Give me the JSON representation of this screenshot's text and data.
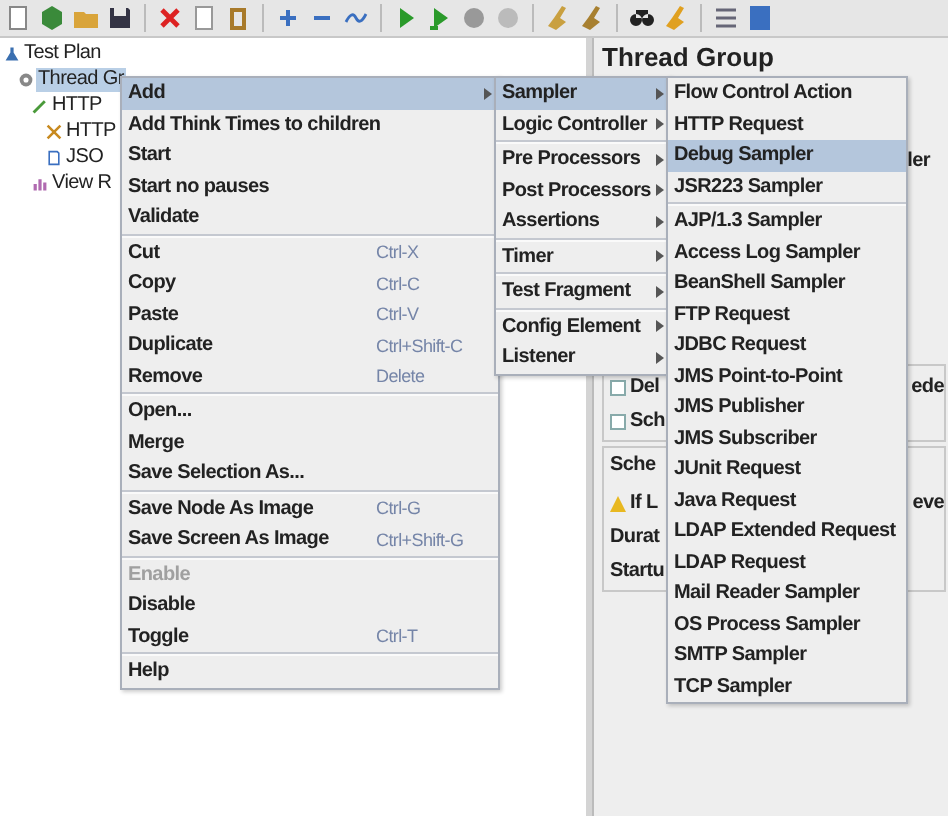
{
  "tree": [
    {
      "label": "Test Plan",
      "kind": "plan",
      "selected": false,
      "children": [
        {
          "label": "Thread Gr",
          "kind": "threads",
          "selected": true,
          "children": [
            {
              "label": "HTTP",
              "kind": "config",
              "selected": false,
              "children": [
                {
                  "label": "HTTP",
                  "kind": "sampler",
                  "selected": false
                },
                {
                  "label": "JSO",
                  "kind": "extractor",
                  "selected": false
                }
              ]
            },
            {
              "label": "View R",
              "kind": "listener",
              "selected": false
            }
          ]
        }
      ]
    }
  ],
  "editor": {
    "title": "Thread Group",
    "hint": "ler",
    "options": [
      {
        "label": "Del",
        "checked": false,
        "tail": "ede"
      },
      {
        "label": "Sch",
        "checked": false
      }
    ],
    "scheduler": {
      "title": "Sche",
      "warning": "If L",
      "warning_tail": "eve",
      "fields": [
        "Durat",
        "Startu"
      ]
    }
  },
  "menus": [
    {
      "items": [
        {
          "kind": "item",
          "label": "Add",
          "selected": true,
          "disabled": false,
          "submenu": true
        },
        {
          "kind": "item",
          "label": "Add Think Times to children",
          "selected": false,
          "disabled": false,
          "submenu": false
        },
        {
          "kind": "item",
          "label": "Start",
          "selected": false,
          "disabled": false,
          "submenu": false
        },
        {
          "kind": "item",
          "label": "Start no pauses",
          "selected": false,
          "disabled": false,
          "submenu": false
        },
        {
          "kind": "item",
          "label": "Validate",
          "selected": false,
          "disabled": false,
          "submenu": false
        },
        {
          "kind": "separator"
        },
        {
          "kind": "item",
          "label": "Cut",
          "shortcut": "Ctrl-X",
          "selected": false,
          "disabled": false,
          "submenu": false
        },
        {
          "kind": "item",
          "label": "Copy",
          "shortcut": "Ctrl-C",
          "selected": false,
          "disabled": false,
          "submenu": false
        },
        {
          "kind": "item",
          "label": "Paste",
          "shortcut": "Ctrl-V",
          "selected": false,
          "disabled": false,
          "submenu": false
        },
        {
          "kind": "item",
          "label": "Duplicate",
          "shortcut": "Ctrl+Shift-C",
          "selected": false,
          "disabled": false,
          "submenu": false
        },
        {
          "kind": "item",
          "label": "Remove",
          "shortcut": "Delete",
          "selected": false,
          "disabled": false,
          "submenu": false
        },
        {
          "kind": "separator"
        },
        {
          "kind": "item",
          "label": "Open...",
          "selected": false,
          "disabled": false,
          "submenu": false
        },
        {
          "kind": "item",
          "label": "Merge",
          "selected": false,
          "disabled": false,
          "submenu": false
        },
        {
          "kind": "item",
          "label": "Save Selection As...",
          "selected": false,
          "disabled": false,
          "submenu": false
        },
        {
          "kind": "separator"
        },
        {
          "kind": "item",
          "label": "Save Node As Image",
          "shortcut": "Ctrl-G",
          "selected": false,
          "disabled": false,
          "submenu": false
        },
        {
          "kind": "item",
          "label": "Save Screen As Image",
          "shortcut": "Ctrl+Shift-G",
          "selected": false,
          "disabled": false,
          "submenu": false
        },
        {
          "kind": "separator"
        },
        {
          "kind": "item",
          "label": "Enable",
          "selected": false,
          "disabled": true,
          "submenu": false
        },
        {
          "kind": "item",
          "label": "Disable",
          "selected": false,
          "disabled": false,
          "submenu": false
        },
        {
          "kind": "item",
          "label": "Toggle",
          "shortcut": "Ctrl-T",
          "selected": false,
          "disabled": false,
          "submenu": false
        },
        {
          "kind": "separator"
        },
        {
          "kind": "item",
          "label": "Help",
          "selected": false,
          "disabled": false,
          "submenu": false
        }
      ]
    },
    {
      "items": [
        {
          "kind": "item",
          "label": "Sampler",
          "selected": true,
          "disabled": false,
          "submenu": true
        },
        {
          "kind": "item",
          "label": "Logic Controller",
          "selected": false,
          "disabled": false,
          "submenu": true
        },
        {
          "kind": "separator"
        },
        {
          "kind": "item",
          "label": "Pre Processors",
          "selected": false,
          "disabled": false,
          "submenu": true
        },
        {
          "kind": "item",
          "label": "Post Processors",
          "selected": false,
          "disabled": false,
          "submenu": true
        },
        {
          "kind": "item",
          "label": "Assertions",
          "selected": false,
          "disabled": false,
          "submenu": true
        },
        {
          "kind": "separator"
        },
        {
          "kind": "item",
          "label": "Timer",
          "selected": false,
          "disabled": false,
          "submenu": true
        },
        {
          "kind": "separator"
        },
        {
          "kind": "item",
          "label": "Test Fragment",
          "selected": false,
          "disabled": false,
          "submenu": true
        },
        {
          "kind": "separator"
        },
        {
          "kind": "item",
          "label": "Config Element",
          "selected": false,
          "disabled": false,
          "submenu": true
        },
        {
          "kind": "item",
          "label": "Listener",
          "selected": false,
          "disabled": false,
          "submenu": true
        }
      ]
    },
    {
      "items": [
        {
          "kind": "item",
          "label": "Flow Control Action",
          "selected": false,
          "disabled": false,
          "submenu": false
        },
        {
          "kind": "item",
          "label": "HTTP Request",
          "selected": false,
          "disabled": false,
          "submenu": false
        },
        {
          "kind": "item",
          "label": "Debug Sampler",
          "selected": true,
          "disabled": false,
          "submenu": false
        },
        {
          "kind": "item",
          "label": "JSR223 Sampler",
          "selected": false,
          "disabled": false,
          "submenu": false
        },
        {
          "kind": "separator"
        },
        {
          "kind": "item",
          "label": "AJP/1.3 Sampler",
          "selected": false,
          "disabled": false,
          "submenu": false
        },
        {
          "kind": "item",
          "label": "Access Log Sampler",
          "selected": false,
          "disabled": false,
          "submenu": false
        },
        {
          "kind": "item",
          "label": "BeanShell Sampler",
          "selected": false,
          "disabled": false,
          "submenu": false
        },
        {
          "kind": "item",
          "label": "FTP Request",
          "selected": false,
          "disabled": false,
          "submenu": false
        },
        {
          "kind": "item",
          "label": "JDBC Request",
          "selected": false,
          "disabled": false,
          "submenu": false
        },
        {
          "kind": "item",
          "label": "JMS Point-to-Point",
          "selected": false,
          "disabled": false,
          "submenu": false
        },
        {
          "kind": "item",
          "label": "JMS Publisher",
          "selected": false,
          "disabled": false,
          "submenu": false
        },
        {
          "kind": "item",
          "label": "JMS Subscriber",
          "selected": false,
          "disabled": false,
          "submenu": false
        },
        {
          "kind": "item",
          "label": "JUnit Request",
          "selected": false,
          "disabled": false,
          "submenu": false
        },
        {
          "kind": "item",
          "label": "Java Request",
          "selected": false,
          "disabled": false,
          "submenu": false
        },
        {
          "kind": "item",
          "label": "LDAP Extended Request",
          "selected": false,
          "disabled": false,
          "submenu": false
        },
        {
          "kind": "item",
          "label": "LDAP Request",
          "selected": false,
          "disabled": false,
          "submenu": false
        },
        {
          "kind": "item",
          "label": "Mail Reader Sampler",
          "selected": false,
          "disabled": false,
          "submenu": false
        },
        {
          "kind": "item",
          "label": "OS Process Sampler",
          "selected": false,
          "disabled": false,
          "submenu": false
        },
        {
          "kind": "item",
          "label": "SMTP Sampler",
          "selected": false,
          "disabled": false,
          "submenu": false
        },
        {
          "kind": "item",
          "label": "TCP Sampler",
          "selected": false,
          "disabled": false,
          "submenu": false
        }
      ]
    }
  ]
}
